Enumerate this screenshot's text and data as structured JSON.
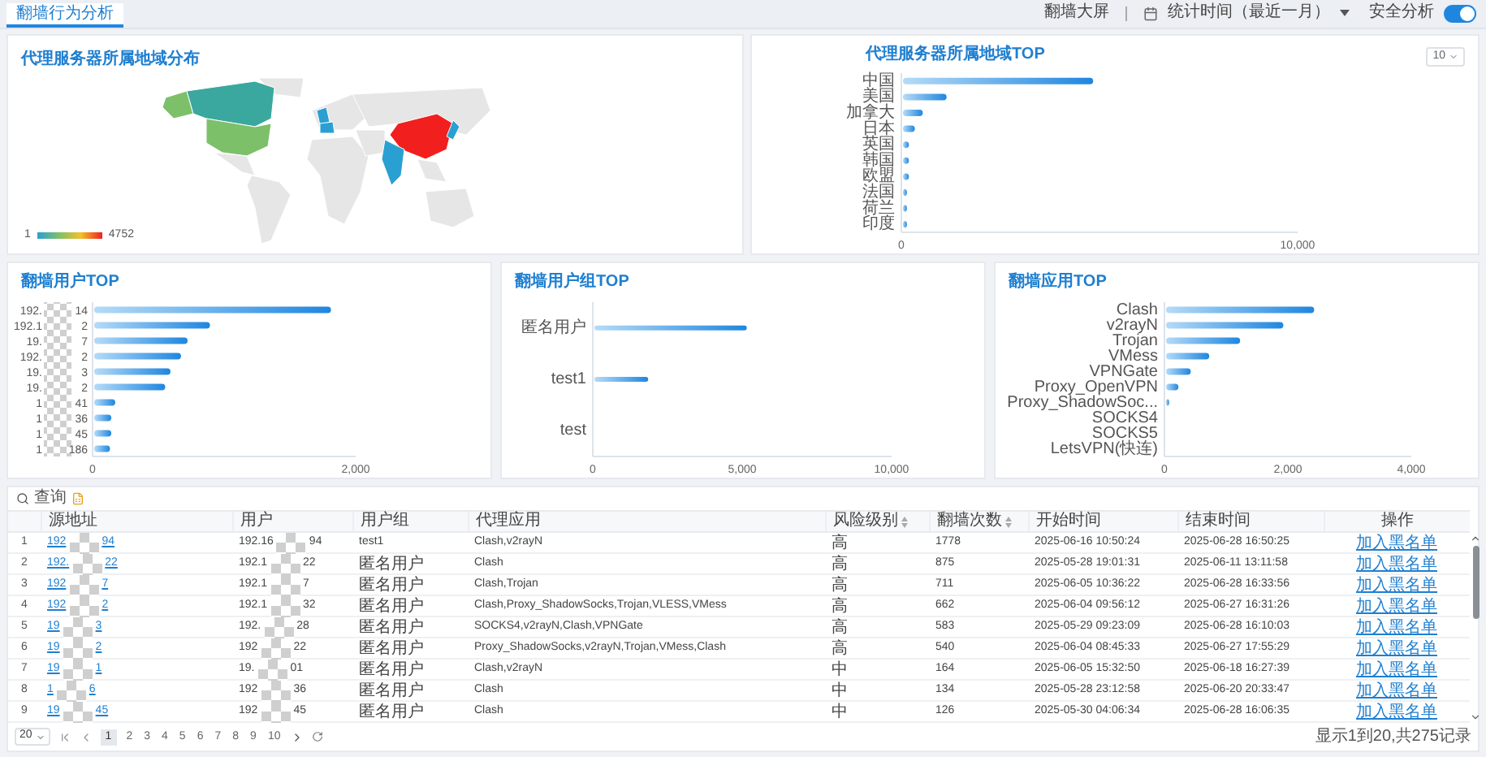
{
  "tabs": [
    {
      "label": "翻墙行为分析",
      "selected": true
    }
  ],
  "toolbar": {
    "screen_link": "翻墙大屏",
    "time_range": "统计时间（最近一月）",
    "analysis_toggle": {
      "label": "安全分析",
      "on": true
    }
  },
  "map_panel": {
    "title": "代理服务器所属地域分布",
    "legend": {
      "min": "1",
      "max": "4752"
    }
  },
  "region_panel": {
    "top_select": "10",
    "chart_data": {
      "type": "bar",
      "orientation": "horizontal",
      "title": "代理服务器所属地域TOP",
      "categories": [
        "中国",
        "美国",
        "加拿大",
        "日本",
        "英国",
        "韩国",
        "欧盟",
        "法国",
        "荷兰",
        "印度"
      ],
      "values": [
        4800,
        1100,
        500,
        300,
        150,
        150,
        150,
        100,
        100,
        100
      ],
      "xlim": [
        0,
        10000
      ],
      "xticks": [
        {
          "value": 0,
          "label": "0"
        },
        {
          "value": 10000,
          "label": "10,000"
        }
      ]
    }
  },
  "user_panel": {
    "chart_data": {
      "type": "bar",
      "orientation": "horizontal",
      "title": "翻墙用户TOP",
      "categories": [
        "192. 14",
        "192.1 2",
        "19. 7",
        "192. 2",
        "19. 3",
        "19. 2",
        "1 41",
        "1 36",
        "1 45",
        "1 186"
      ],
      "values": [
        1800,
        880,
        710,
        660,
        580,
        540,
        160,
        130,
        130,
        120
      ],
      "xlim": [
        0,
        2000
      ],
      "xticks": [
        {
          "value": 0,
          "label": "0"
        },
        {
          "value": 2000,
          "label": "2,000"
        }
      ]
    }
  },
  "group_panel": {
    "chart_data": {
      "type": "bar",
      "orientation": "horizontal",
      "title": "翻墙用户组TOP",
      "categories": [
        "匿名用户",
        "test1",
        "test"
      ],
      "values": [
        5100,
        1800,
        0
      ],
      "xlim": [
        0,
        10000
      ],
      "xticks": [
        {
          "value": 0,
          "label": "0"
        },
        {
          "value": 5000,
          "label": "5,000"
        },
        {
          "value": 10000,
          "label": "10,000"
        }
      ]
    }
  },
  "app_panel": {
    "chart_data": {
      "type": "bar",
      "orientation": "horizontal",
      "title": "翻墙应用TOP",
      "categories": [
        "Clash",
        "v2rayN",
        "Trojan",
        "VMess",
        "VPNGate",
        "Proxy_OpenVPN",
        "Proxy_ShadowSoc...",
        "SOCKS4",
        "SOCKS5",
        "LetsVPN(快连)"
      ],
      "values": [
        2400,
        1900,
        1200,
        700,
        400,
        200,
        50,
        0,
        0,
        0
      ],
      "xlim": [
        0,
        4000
      ],
      "xticks": [
        {
          "value": 0,
          "label": "0"
        },
        {
          "value": 2000,
          "label": "2,000"
        },
        {
          "value": 4000,
          "label": "4,000"
        }
      ]
    }
  },
  "table": {
    "search_label": "查询",
    "columns": [
      {
        "label": "源地址",
        "sortable": false
      },
      {
        "label": "用户",
        "sortable": false
      },
      {
        "label": "用户组",
        "sortable": false
      },
      {
        "label": "代理应用",
        "sortable": false
      },
      {
        "label": "风险级别",
        "sortable": true
      },
      {
        "label": "翻墙次数",
        "sortable": true
      },
      {
        "label": "开始时间",
        "sortable": false
      },
      {
        "label": "结束时间",
        "sortable": false
      },
      {
        "label": "操作",
        "sortable": false
      }
    ],
    "rows": [
      {
        "index": "1",
        "source": {
          "head": "192",
          "tail": "94"
        },
        "user": {
          "head": "192.16",
          "tail": "94"
        },
        "group": "test1",
        "apps": "Clash,v2rayN",
        "risk": "高",
        "count": "1778",
        "start": "2025-06-16 10:50:24",
        "end": "2025-06-28 16:50:25",
        "action": "加入黑名单"
      },
      {
        "index": "2",
        "source": {
          "head": "192.",
          "tail": "22"
        },
        "user": {
          "head": "192.1",
          "tail": "22"
        },
        "group": "匿名用户",
        "apps": "Clash",
        "risk": "高",
        "count": "875",
        "start": "2025-05-28 19:01:31",
        "end": "2025-06-11 13:11:58",
        "action": "加入黑名单"
      },
      {
        "index": "3",
        "source": {
          "head": "192",
          "tail": "7"
        },
        "user": {
          "head": "192.1",
          "tail": "7"
        },
        "group": "匿名用户",
        "apps": "Clash,Trojan",
        "risk": "高",
        "count": "711",
        "start": "2025-06-05 10:36:22",
        "end": "2025-06-28 16:33:56",
        "action": "加入黑名单"
      },
      {
        "index": "4",
        "source": {
          "head": "192",
          "tail": "2"
        },
        "user": {
          "head": "192.1",
          "tail": "32"
        },
        "group": "匿名用户",
        "apps": "Clash,Proxy_ShadowSocks,Trojan,VLESS,VMess",
        "risk": "高",
        "count": "662",
        "start": "2025-06-04 09:56:12",
        "end": "2025-06-27 16:31:26",
        "action": "加入黑名单"
      },
      {
        "index": "5",
        "source": {
          "head": "19",
          "tail": "3"
        },
        "user": {
          "head": "192.",
          "tail": "28"
        },
        "group": "匿名用户",
        "apps": "SOCKS4,v2rayN,Clash,VPNGate",
        "risk": "高",
        "count": "583",
        "start": "2025-05-29 09:23:09",
        "end": "2025-06-28 16:10:03",
        "action": "加入黑名单"
      },
      {
        "index": "6",
        "source": {
          "head": "19",
          "tail": "2"
        },
        "user": {
          "head": "192",
          "tail": "22"
        },
        "group": "匿名用户",
        "apps": "Proxy_ShadowSocks,v2rayN,Trojan,VMess,Clash",
        "risk": "高",
        "count": "540",
        "start": "2025-06-04 08:45:33",
        "end": "2025-06-27 17:55:29",
        "action": "加入黑名单"
      },
      {
        "index": "7",
        "source": {
          "head": "19",
          "tail": "1"
        },
        "user": {
          "head": "19.",
          "tail": "01"
        },
        "group": "匿名用户",
        "apps": "Clash,v2rayN",
        "risk": "中",
        "count": "164",
        "start": "2025-06-05 15:32:50",
        "end": "2025-06-18 16:27:39",
        "action": "加入黑名单"
      },
      {
        "index": "8",
        "source": {
          "head": "1",
          "tail": "6"
        },
        "user": {
          "head": "192",
          "tail": "36"
        },
        "group": "匿名用户",
        "apps": "Clash",
        "risk": "中",
        "count": "134",
        "start": "2025-05-28 23:12:58",
        "end": "2025-06-20 20:33:47",
        "action": "加入黑名单"
      },
      {
        "index": "9",
        "source": {
          "head": "19",
          "tail": "45"
        },
        "user": {
          "head": "192",
          "tail": "45"
        },
        "group": "匿名用户",
        "apps": "Clash",
        "risk": "中",
        "count": "126",
        "start": "2025-05-30 04:06:34",
        "end": "2025-06-28 16:06:35",
        "action": "加入黑名单"
      }
    ]
  },
  "pagination": {
    "page_size": "20",
    "pages": [
      {
        "label": "1",
        "selected": true
      },
      {
        "label": "2",
        "selected": false
      },
      {
        "label": "3",
        "selected": false
      },
      {
        "label": "4",
        "selected": false
      },
      {
        "label": "5",
        "selected": false
      },
      {
        "label": "6",
        "selected": false
      },
      {
        "label": "7",
        "selected": false
      },
      {
        "label": "8",
        "selected": false
      },
      {
        "label": "9",
        "selected": false
      },
      {
        "label": "10",
        "selected": false
      }
    ],
    "summary": "显示1到20,共275记录"
  }
}
